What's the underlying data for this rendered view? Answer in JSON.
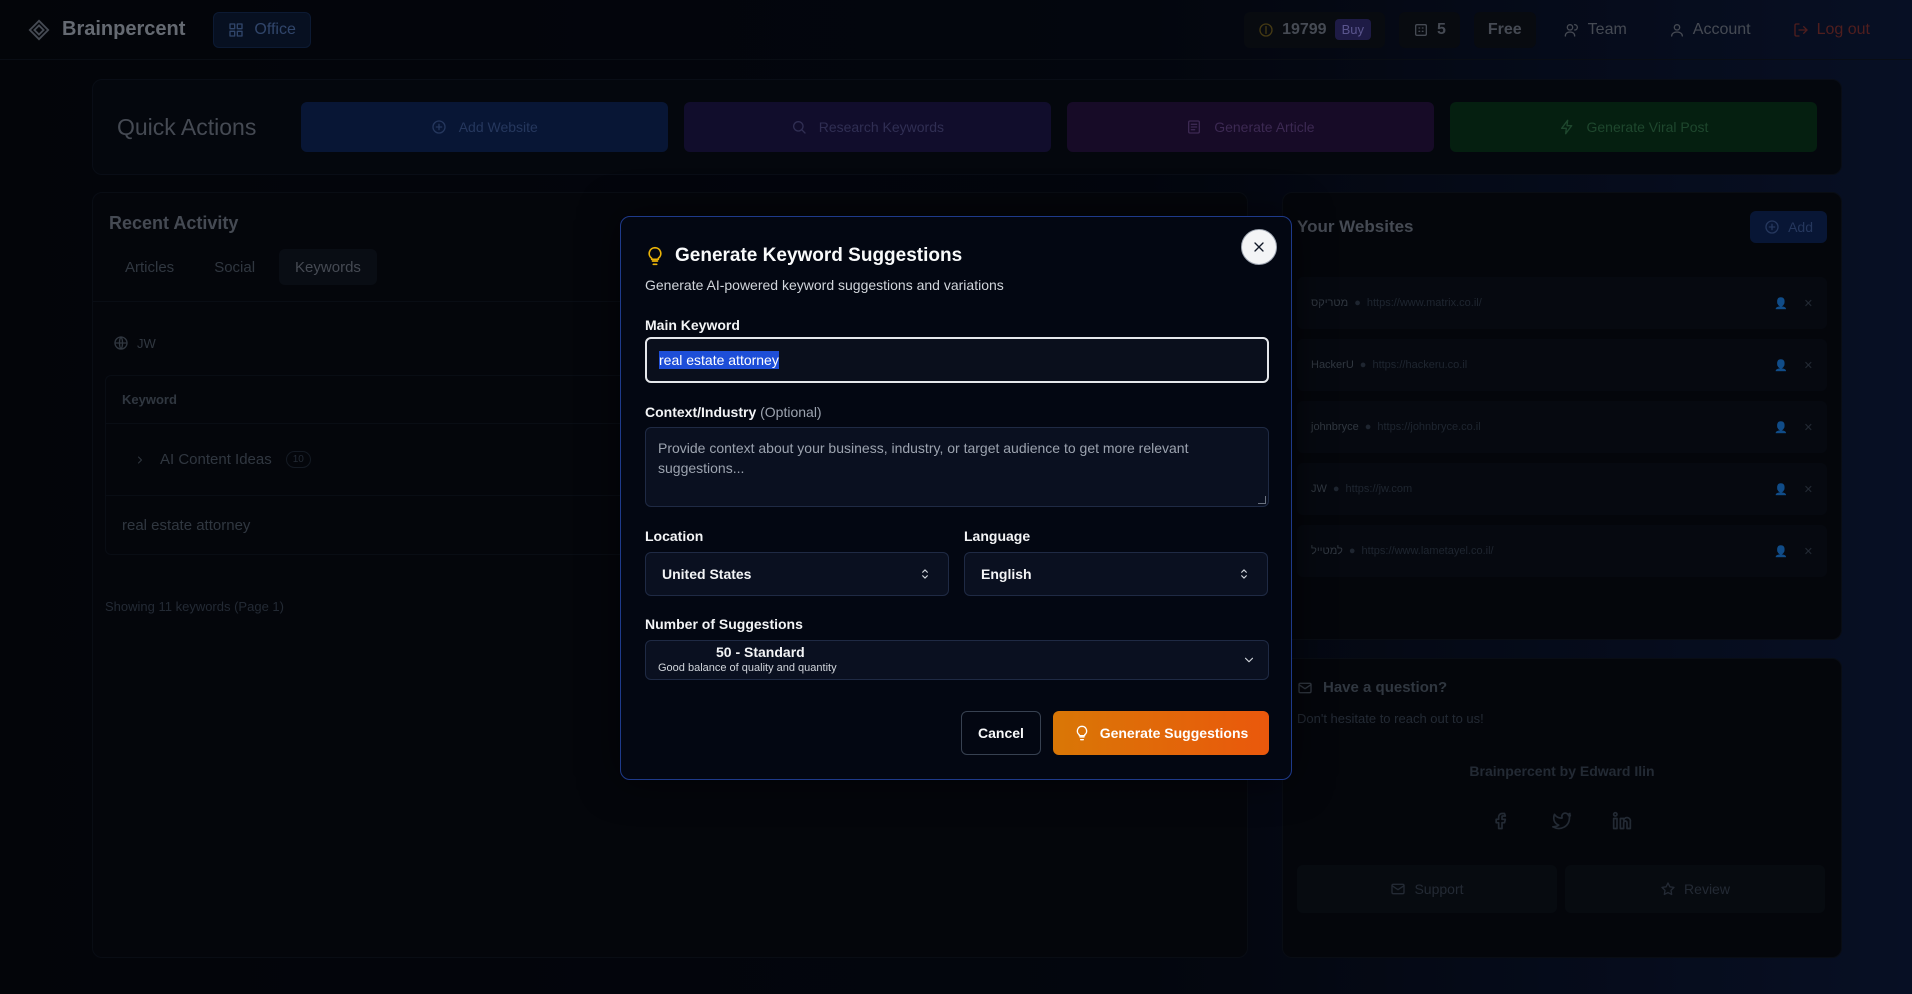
{
  "nav": {
    "brand": "Brainpercent",
    "office": "Office",
    "credits": "19799",
    "buy": "Buy",
    "sites_count": "5",
    "plan": "Free",
    "team": "Team",
    "account": "Account",
    "logout": "Log out"
  },
  "quick_actions": {
    "title": "Quick Actions",
    "add_website": "Add Website",
    "research_keywords": "Research Keywords",
    "generate_article": "Generate Article",
    "generate_viral_post": "Generate Viral Post"
  },
  "recent": {
    "title": "Recent Activity",
    "tabs": [
      "Articles",
      "Social",
      "Keywords"
    ],
    "site": "JW",
    "column_keyword": "Keyword",
    "group_label": "AI Content Ideas",
    "group_count": "10",
    "row_keyword": "real estate attorney",
    "showing": "Showing 11 keywords (Page 1)"
  },
  "websites": {
    "title": "Your Websites",
    "add": "Add",
    "items": [
      {
        "name": "מטריקס",
        "url": "https://www.matrix.co.il/"
      },
      {
        "name": "HackerU",
        "url": "https://hackeru.co.il"
      },
      {
        "name": "johnbryce",
        "url": "https://johnbryce.co.il"
      },
      {
        "name": "JW",
        "url": "https://jw.com"
      },
      {
        "name": "למטייל",
        "url": "https://www.lametayel.co.il/"
      }
    ]
  },
  "question": {
    "title": "Have a question?",
    "subtitle": "Don't hesitate to reach out to us!",
    "credit": "Brainpercent by Edward Ilin",
    "support": "Support",
    "review": "Review"
  },
  "modal": {
    "title": "Generate Keyword Suggestions",
    "description": "Generate AI-powered keyword suggestions and variations",
    "main_keyword_label": "Main Keyword",
    "main_keyword_value": "real estate attorney",
    "context_label": "Context/Industry",
    "context_optional": "(Optional)",
    "context_placeholder": "Provide context about your business, industry, or target audience to get more relevant suggestions...",
    "location_label": "Location",
    "location_value": "United States",
    "language_label": "Language",
    "language_value": "English",
    "num_label": "Number of Suggestions",
    "num_value": "50 - Standard",
    "num_desc": "Good balance of quality and quantity",
    "cancel": "Cancel",
    "generate": "Generate Suggestions"
  },
  "colors": {
    "accent_orange": "#ea580c",
    "modal_border": "#1e3a8a",
    "selection": "#1d4ed8"
  }
}
